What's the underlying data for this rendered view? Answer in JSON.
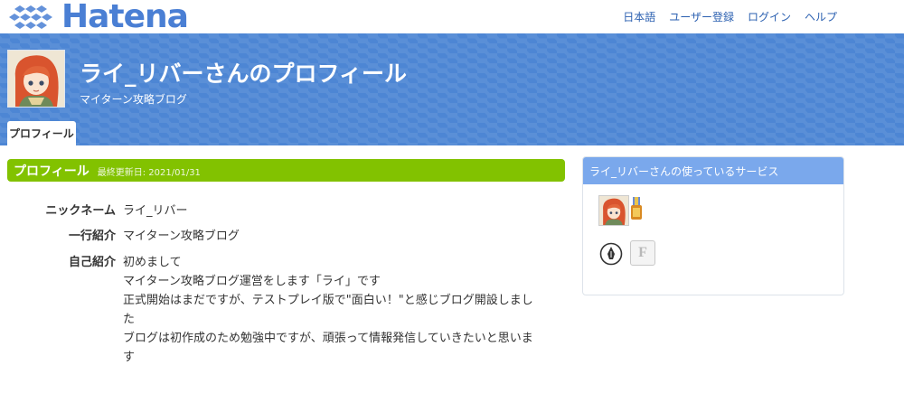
{
  "header": {
    "logo_text": "Hatena",
    "nav": [
      "日本語",
      "ユーザー登録",
      "ログイン",
      "ヘルプ"
    ]
  },
  "banner": {
    "title": "ライ_リバーさんのプロフィール",
    "subtitle": "マイターン攻略ブログ",
    "tab": "プロフィール"
  },
  "profile": {
    "section_title": "プロフィール",
    "updated": "最終更新日: 2021/01/31",
    "rows": [
      {
        "label": "ニックネーム",
        "value": "ライ_リバー"
      },
      {
        "label": "一行紹介",
        "value": "マイターン攻略ブログ"
      },
      {
        "label": "自己紹介",
        "lines": [
          "初めまして",
          "マイターン攻略ブログ運営をします「ライ」です",
          "正式開始はまだですが、テストプレイ版で\"面白い！\"と感じブログ開設しまし",
          "た",
          "ブログは初作成のため勉強中ですが、頑張って情報発信していきたいと思いま",
          "す"
        ]
      }
    ]
  },
  "sidebar": {
    "title": "ライ_リバーさんの使っているサービス",
    "services": [
      "avatar-icon",
      "medal-icon",
      "pen-nib-icon",
      "f-letter-icon"
    ]
  },
  "colors": {
    "banner": "#4d86d4",
    "section_head": "#82c200",
    "side_head": "#7aa8ec",
    "link": "#2a5fb0"
  }
}
